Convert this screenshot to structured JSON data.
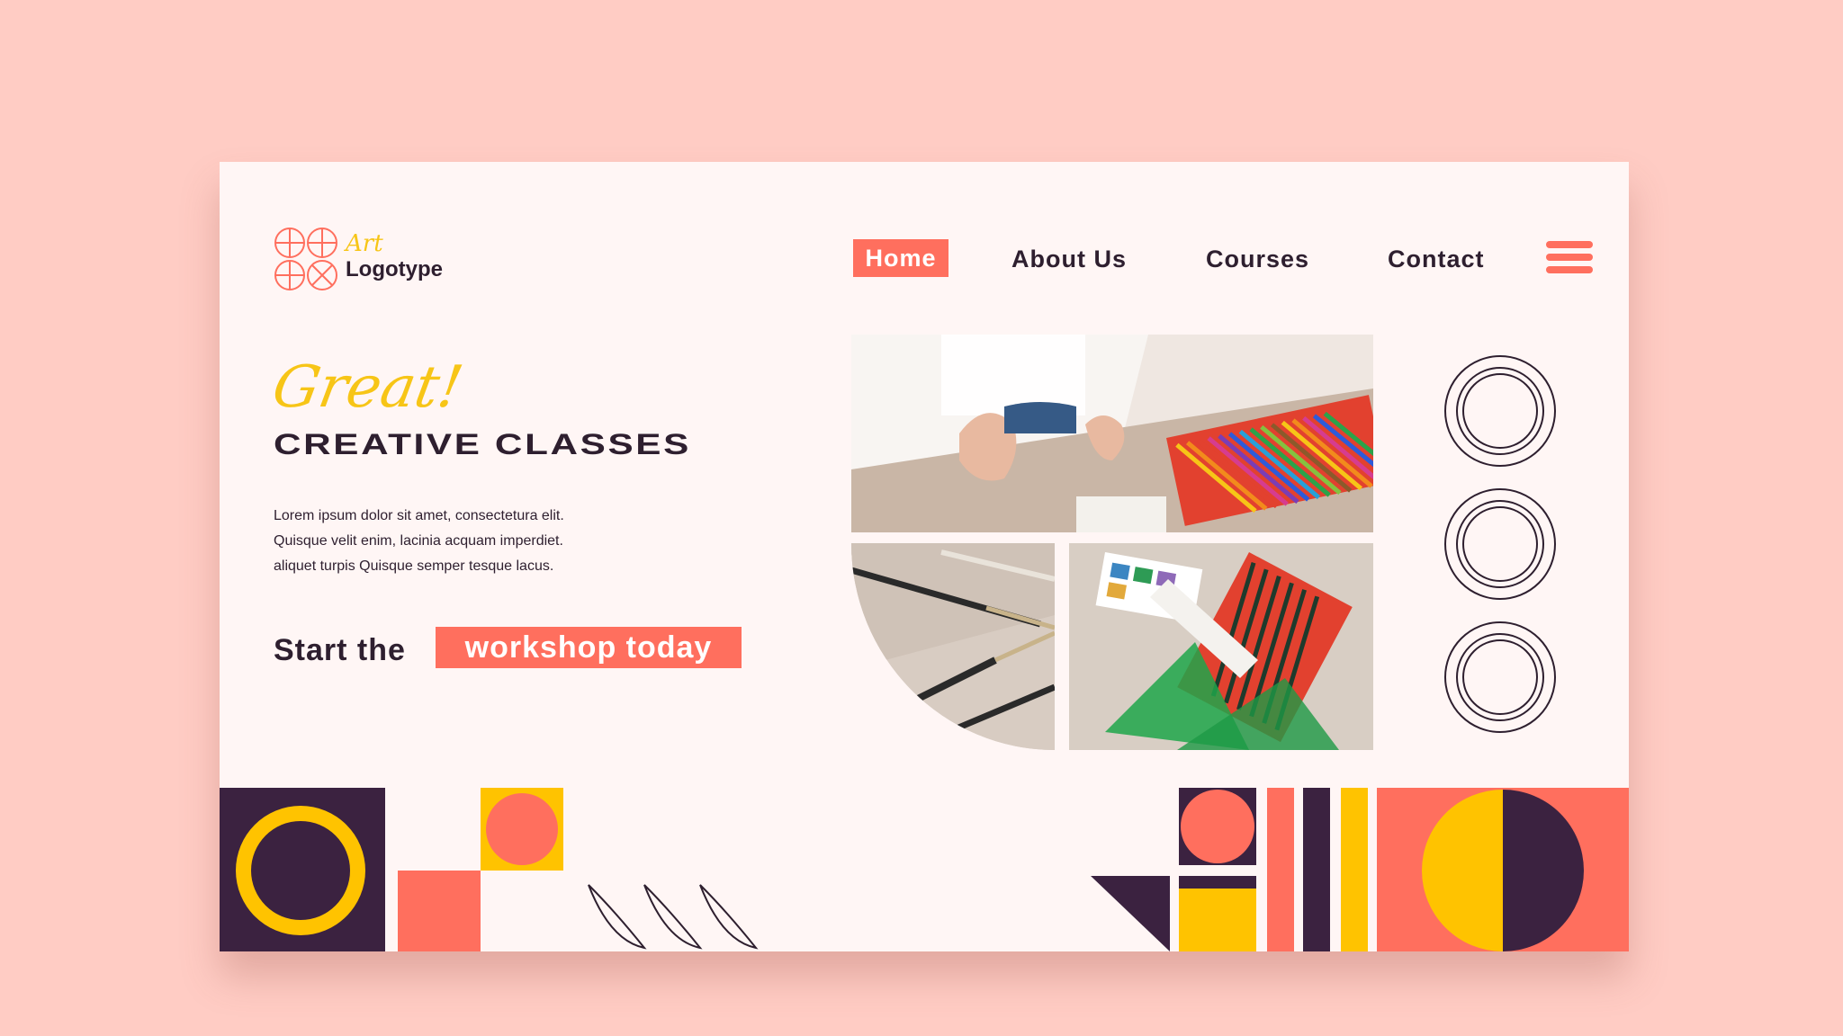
{
  "logo": {
    "script": "Art",
    "name": "Logotype"
  },
  "nav": {
    "home": "Home",
    "about": "About Us",
    "courses": "Courses",
    "contact": "Contact"
  },
  "hero": {
    "script": "Great!",
    "title": "CREATIVE CLASSES",
    "body": [
      "Lorem ipsum dolor sit amet, consectetura elit.",
      "Quisque velit enim, lacinia acquam imperdiet.",
      "aliquet turpis Quisque semper tesque lacus."
    ],
    "cta_lead": "Start the",
    "cta_highlight": "workshop today"
  },
  "colors": {
    "background": "#FFCCC4",
    "card": "#FFF6F5",
    "coral": "#FF6F5E",
    "yellow": "#FFC300",
    "plum": "#3B2240",
    "text": "#2E1F2F"
  },
  "icons": {
    "logo": "four-circle-grid-icon",
    "menu": "hamburger-menu-icon",
    "rings": "concentric-ring-icon"
  }
}
